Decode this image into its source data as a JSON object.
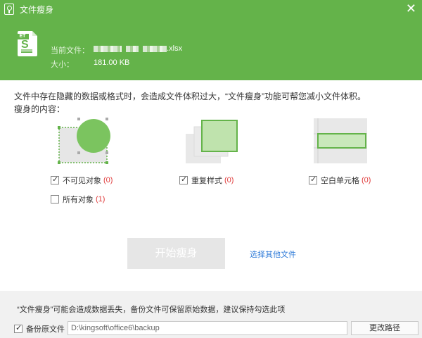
{
  "window": {
    "title": "文件瘦身"
  },
  "file": {
    "icon_badge": "ET",
    "icon_letter": "S",
    "current_label": "当前文件：",
    "current_name_suffix": ".xlsx",
    "size_label": "大小：",
    "size_value": "181.00 KB"
  },
  "main": {
    "description": "文件中存在隐藏的数据或格式时，会造成文件体积过大，“文件瘦身”功能可帮您减小文件体积。",
    "section_label": "瘦身的内容：",
    "options": [
      {
        "label": "不可见对象",
        "count": "(0)",
        "checked": true
      },
      {
        "label": "所有对象",
        "count": "(1)",
        "checked": false
      },
      {
        "label": "重复样式",
        "count": "(0)",
        "checked": true
      },
      {
        "label": "空白单元格",
        "count": "(0)",
        "checked": true
      }
    ],
    "start_button": "开始瘦身",
    "other_file_link": "选择其他文件"
  },
  "footer": {
    "warning": "“文件瘦身”可能会造成数据丢失，备份文件可保留原始数据，建议保持勾选此项",
    "backup_label": "备份原文件",
    "backup_checked": true,
    "backup_path": "D:\\kingsoft\\office6\\backup",
    "change_path_button": "更改路径"
  },
  "colors": {
    "accent": "#64b34a",
    "link": "#2f7bd8",
    "count": "#e03c3c"
  }
}
